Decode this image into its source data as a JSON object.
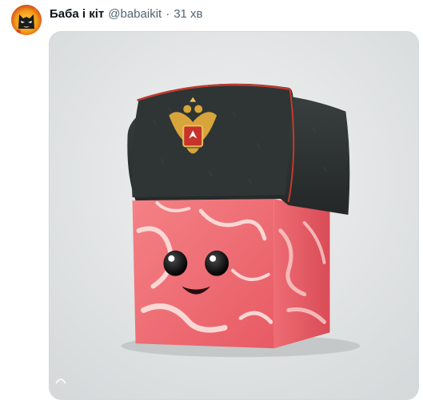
{
  "tweet": {
    "author_name": "Баба і кіт",
    "author_handle": "@babaikit",
    "separator": "·",
    "timestamp": "31 хв"
  },
  "avatar": {
    "icon": "cat-mask-avatar-icon",
    "bg": "#f2b21b"
  },
  "media": {
    "icon": "meat-cube-with-ushanka-illustration",
    "background": "#e2e5e6",
    "meat_color": "#f1727a",
    "hat_color": "#2c3131",
    "emblem_color": "#d8a53c"
  },
  "theme": {
    "name_color": "#0f1419",
    "muted_color": "#536471",
    "border_color": "#cfd9de"
  }
}
